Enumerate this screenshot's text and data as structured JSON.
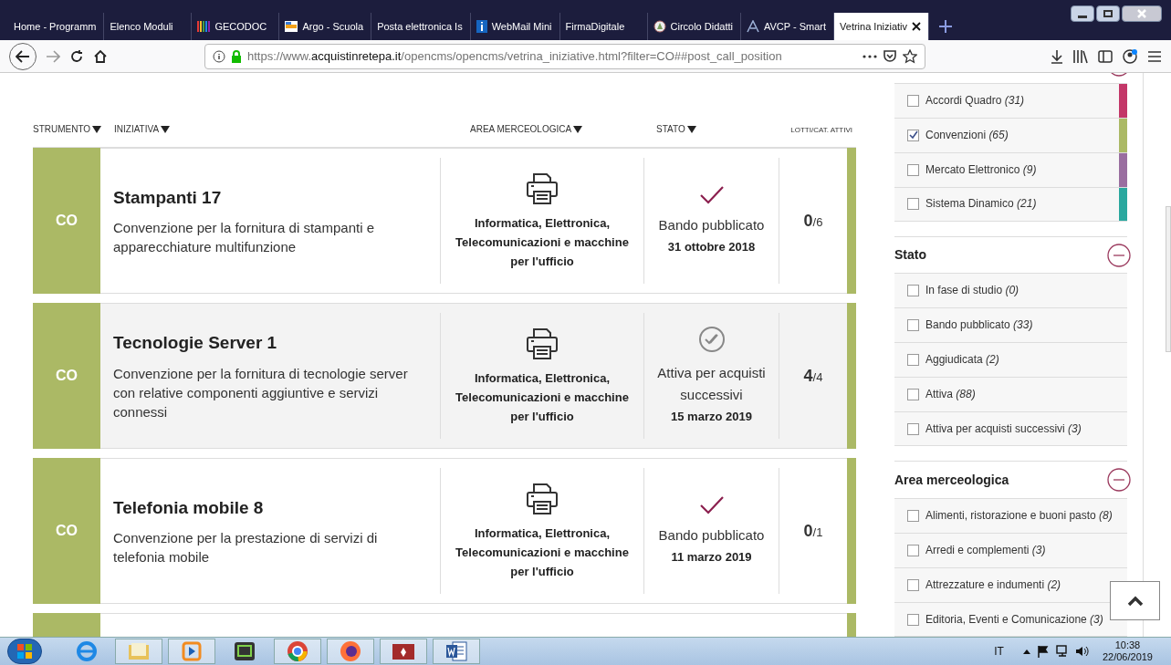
{
  "browser": {
    "tabs": [
      {
        "label": "Home - Programm",
        "selected": false
      },
      {
        "label": "Elenco Moduli",
        "selected": false
      },
      {
        "label": "GECODOC",
        "selected": false
      },
      {
        "label": "Argo - Scuola",
        "selected": false
      },
      {
        "label": "Posta elettronica Is",
        "selected": false
      },
      {
        "label": "WebMail Mini",
        "selected": false
      },
      {
        "label": "FirmaDigitale",
        "selected": false
      },
      {
        "label": "Circolo Didatti",
        "selected": false
      },
      {
        "label": "AVCP - Smart",
        "selected": false
      },
      {
        "label": "Vetrina Iniziativ",
        "selected": true
      }
    ],
    "url": {
      "prefix": "https://www.",
      "domain": "acquistinretepa.it",
      "path": "/opencms/opencms/vetrina_iniziative.html?filter=CO##post_call_position"
    }
  },
  "table": {
    "columns": [
      {
        "label": "STRUMENTO",
        "sortable": true
      },
      {
        "label": "INIZIATIVA",
        "sortable": true
      },
      {
        "label": "AREA MERCEOLOGICA",
        "sortable": true
      },
      {
        "label": "STATO",
        "sortable": true
      },
      {
        "label": "LOTTI/CAT. ATTIVI",
        "sortable": false
      }
    ],
    "rows": [
      {
        "tool": "CO",
        "color": "#abb965",
        "title": "Stampanti 17",
        "description": "Convenzione per la fornitura di stampanti e apparecchiature multifunzione",
        "area": "Informatica, Elettronica, Telecomunicazioni e macchine per l'ufficio",
        "kind": "published",
        "status": "Bando pubblicato",
        "date": "31 ottobre 2018",
        "lots_active": "0",
        "lots_total": "/6",
        "highlighted": false
      },
      {
        "tool": "CO",
        "color": "#abb965",
        "title": "Tecnologie Server 1",
        "description": "Convenzione per la fornitura di tecnologie server con relative componenti aggiuntive e servizi connessi",
        "area": "Informatica, Elettronica, Telecomunicazioni e macchine per l'ufficio",
        "kind": "active",
        "status": "Attiva per acquisti successivi",
        "date": "15 marzo 2019",
        "lots_active": "4",
        "lots_total": "/4",
        "highlighted": true
      },
      {
        "tool": "CO",
        "color": "#abb965",
        "title": "Telefonia mobile 8",
        "description": "Convenzione per la prestazione di servizi di telefonia mobile",
        "area": "Informatica, Elettronica, Telecomunicazioni e macchine per l'ufficio",
        "kind": "published",
        "status": "Bando pubblicato",
        "date": "11 marzo 2019",
        "lots_active": "0",
        "lots_total": "/1",
        "highlighted": false
      }
    ]
  },
  "filters": [
    {
      "items": [
        {
          "label": "Accordi Quadro",
          "count": "(31)",
          "checked": false,
          "color": "#c33768"
        },
        {
          "label": "Convenzioni",
          "count": "(65)",
          "checked": true,
          "color": "#abb965"
        },
        {
          "label": "Mercato Elettronico",
          "count": "(9)",
          "checked": false,
          "color": "#9a6ea0"
        },
        {
          "label": "Sistema Dinamico",
          "count": "(21)",
          "checked": false,
          "color": "#2aa89f"
        }
      ]
    },
    {
      "title": "Stato",
      "items": [
        {
          "label": "In fase di studio",
          "count": "(0)",
          "checked": false
        },
        {
          "label": "Bando pubblicato",
          "count": "(33)",
          "checked": false
        },
        {
          "label": "Aggiudicata",
          "count": "(2)",
          "checked": false
        },
        {
          "label": "Attiva",
          "count": "(88)",
          "checked": false
        },
        {
          "label": "Attiva per acquisti successivi",
          "count": "(3)",
          "checked": false
        }
      ]
    },
    {
      "title": "Area merceologica",
      "items": [
        {
          "label": "Alimenti, ristorazione e buoni pasto",
          "count": "(8)",
          "checked": false
        },
        {
          "label": "Arredi e complementi",
          "count": "(3)",
          "checked": false
        },
        {
          "label": "Attrezzature e indumenti",
          "count": "(2)",
          "checked": false
        },
        {
          "label": "Editoria, Eventi e Comunicazione",
          "count": "(3)",
          "checked": false
        }
      ]
    }
  ],
  "taskbar": {
    "language": "IT",
    "time": "10:38",
    "date": "22/06/2019"
  }
}
